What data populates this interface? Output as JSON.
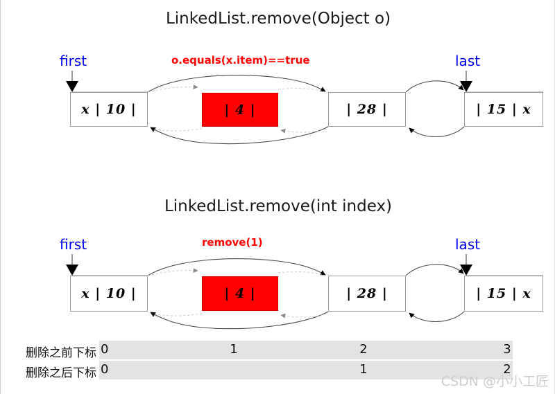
{
  "diagram_1": {
    "title": "LinkedList.remove(Object o)",
    "condition_label": "o.equals(x.item)==true",
    "first_label": "first",
    "last_label": "last",
    "nodes": [
      {
        "text": "x | 10 |",
        "state": "normal"
      },
      {
        "text": "| 4 |",
        "state": "removed"
      },
      {
        "text": "| 28 |",
        "state": "normal"
      },
      {
        "text": "| 15 | x",
        "state": "normal"
      }
    ]
  },
  "diagram_2": {
    "title": "LinkedList.remove(int index)",
    "condition_label": "remove(1)",
    "first_label": "first",
    "last_label": "last",
    "nodes": [
      {
        "text": "x | 10 |",
        "state": "normal"
      },
      {
        "text": "| 4 |",
        "state": "removed"
      },
      {
        "text": "| 28 |",
        "state": "normal"
      },
      {
        "text": "| 15 | x",
        "state": "normal"
      }
    ]
  },
  "index_table": {
    "rows": [
      {
        "label": "删除之前下标",
        "cells": [
          "0",
          "1",
          "2",
          "3"
        ]
      },
      {
        "label": "删除之后下标",
        "cells": [
          "0",
          "1",
          "2"
        ]
      }
    ]
  },
  "watermark": "CSDN @小小工匠",
  "colors": {
    "removed_node": "#ff0000",
    "pointer_label": "#0000ee",
    "condition_label": "#ff0000",
    "node_border": "#9a9a9a",
    "index_bar": "#e3e3e3",
    "watermark": "#cdcdcd"
  }
}
